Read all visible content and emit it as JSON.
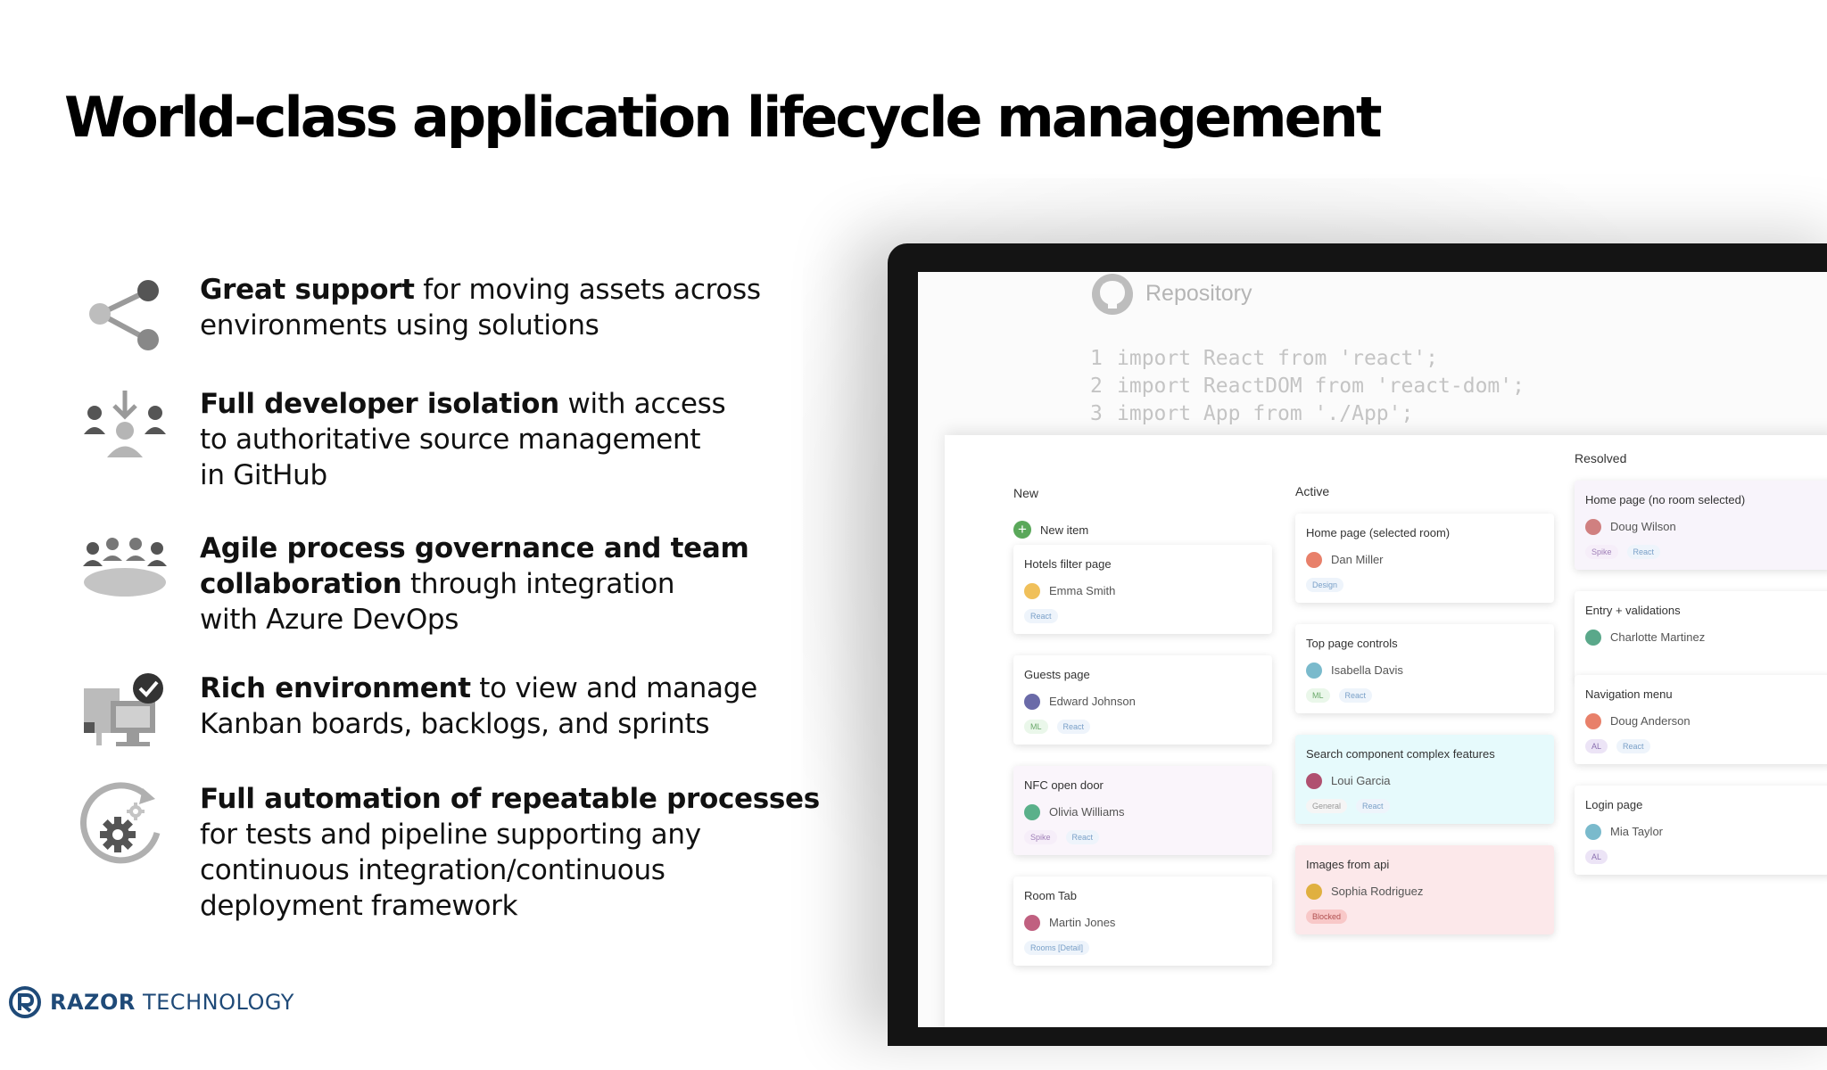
{
  "slide": {
    "title": "World-class application lifecycle management"
  },
  "features": [
    {
      "icon": "share-icon",
      "bold": "Great support",
      "lines": [
        " for moving assets across",
        "environments using solutions"
      ]
    },
    {
      "icon": "developer-isolation-icon",
      "bold": "Full developer isolation",
      "lines": [
        " with access",
        "to authoritative source management",
        "in GitHub"
      ]
    },
    {
      "icon": "team-collaboration-icon",
      "bold": "Agile process governance and team collaboration",
      "rest": " through integration",
      "last": "with Azure DevOps"
    },
    {
      "icon": "environment-check-icon",
      "bold": "Rich environment",
      "lines": [
        " to view and manage",
        "Kanban boards, backlogs, and sprints"
      ]
    },
    {
      "icon": "automation-gear-icon",
      "bold": "Full automation of repeatable processes",
      "lines": [
        "for tests and pipeline supporting any",
        "continuous integration/continuous",
        "deployment framework"
      ]
    }
  ],
  "logo": {
    "bold": "RAZOR",
    "light": "TECHNOLOGY"
  },
  "repo": {
    "title": "Repository",
    "code": [
      {
        "n": "1",
        "t": "import React from 'react';"
      },
      {
        "n": "2",
        "t": "import ReactDOM from 'react-dom';"
      },
      {
        "n": "3",
        "t": "import App from './App';"
      }
    ]
  },
  "board": {
    "columns": {
      "new": "New",
      "active": "Active",
      "resolved": "Resolved"
    },
    "new_item": "New item",
    "cards": [
      {
        "title": "Hotels filter page",
        "assignee": "Emma Smith",
        "tags": [
          "React"
        ]
      },
      {
        "title": "Guests page",
        "assignee": "Edward Johnson",
        "tags": [
          "ML",
          "React"
        ]
      },
      {
        "title": "NFC open door",
        "assignee": "Olivia Williams",
        "tags": [
          "Spike",
          "React"
        ]
      },
      {
        "title": "Room Tab",
        "assignee": "Martin Jones",
        "tags": [
          "Rooms [Detail]"
        ]
      },
      {
        "title": "Home page (selected room)",
        "assignee": "Dan Miller",
        "tags": [
          "Design"
        ]
      },
      {
        "title": "Top page controls",
        "assignee": "Isabella Davis",
        "tags": [
          "ML",
          "React"
        ]
      },
      {
        "title": "Search component complex features",
        "assignee": "Loui Garcia",
        "tags": [
          "General",
          "React"
        ]
      },
      {
        "title": "Images from api",
        "assignee": "Sophia Rodriguez",
        "tags": [
          "Blocked"
        ]
      },
      {
        "title": "Home page (no room selected)",
        "assignee": "Doug Wilson",
        "tags": [
          "Spike",
          "React"
        ]
      },
      {
        "title": "Entry + validations",
        "assignee": "Charlotte Martinez",
        "tags": []
      },
      {
        "title": "Navigation menu",
        "assignee": "Doug Anderson",
        "tags": [
          "AL",
          "React"
        ]
      },
      {
        "title": "Login page",
        "assignee": "Mia Taylor",
        "tags": [
          "AL"
        ]
      }
    ]
  },
  "colors": {
    "title": "#000000",
    "icon_gray": "#9a9a9a",
    "icon_dark": "#505050",
    "logo_blue": "#1f4a78",
    "new_item_green": "#5aa85a"
  }
}
